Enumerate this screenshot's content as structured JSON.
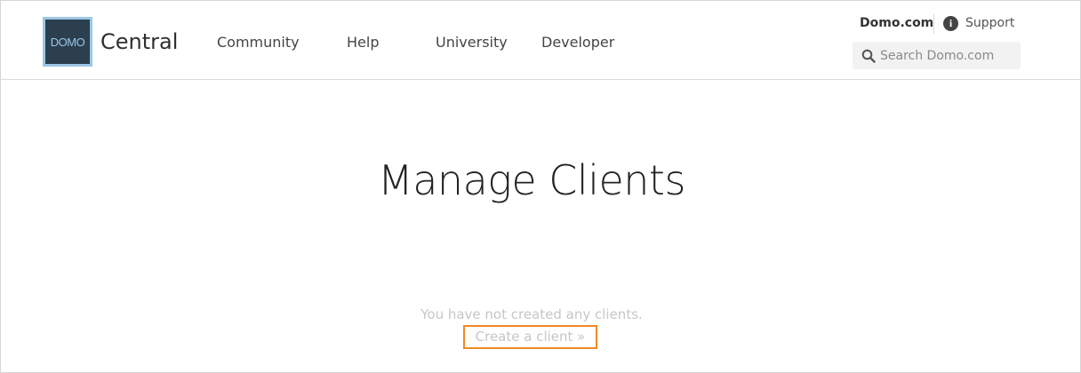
{
  "brand": {
    "logo_text": "DOMO",
    "name": "Central",
    "colors": {
      "logo_border": "#9cc7e6",
      "logo_fill": "#2b3f4e"
    }
  },
  "nav": {
    "items": [
      {
        "label": "Community"
      },
      {
        "label": "Help"
      },
      {
        "label": "University"
      },
      {
        "label": "Developer"
      }
    ]
  },
  "top_links": {
    "domo": "Domo.com",
    "support": "Support",
    "support_icon": "info-icon"
  },
  "search": {
    "placeholder": "Search Domo.com",
    "value": "",
    "icon": "search-icon"
  },
  "main": {
    "title": "Manage Clients",
    "empty_message": "You have not created any clients.",
    "create_link": "Create a client »",
    "highlight_color": "#f08a24"
  }
}
